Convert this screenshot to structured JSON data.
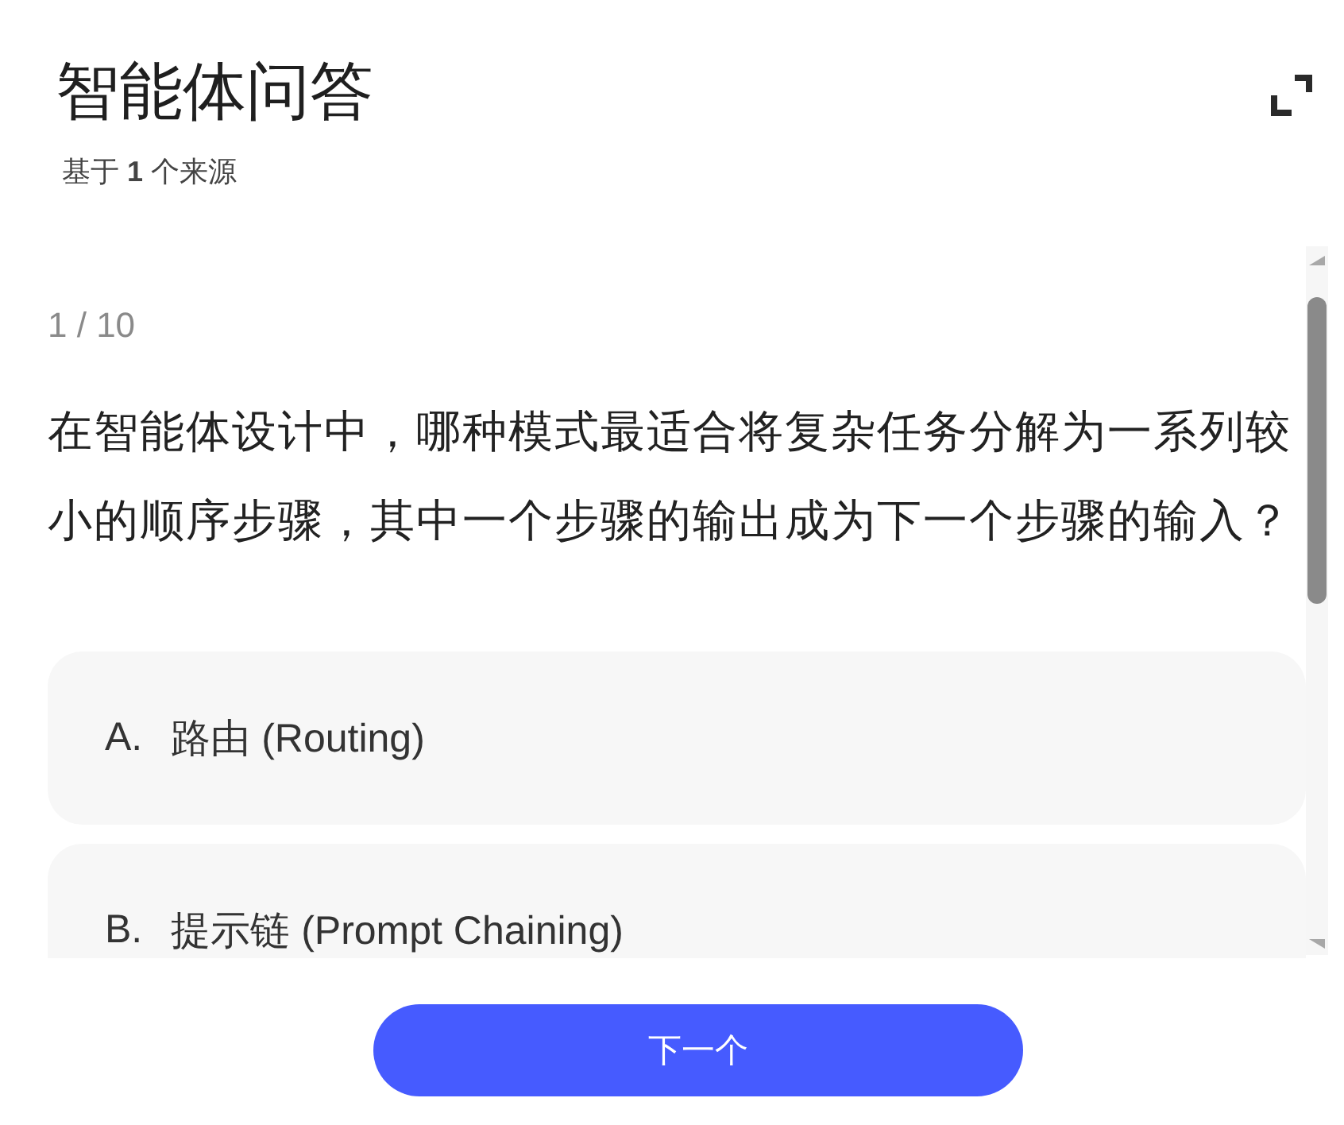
{
  "header": {
    "title": "智能体问答",
    "subtitle": "基于 **1** 个来源"
  },
  "quiz": {
    "counter": "1 / 10",
    "question": "在智能体设计中，哪种模式最适合将复杂任务分解为一系列较小的顺序步骤，其中一个步骤的输出成为下一个步骤的输入？",
    "options": [
      {
        "letter": "A.",
        "text": "路由 (Routing)"
      },
      {
        "letter": "B.",
        "text": "提示链 (Prompt Chaining)"
      }
    ]
  },
  "next_button": {
    "label": "下一个"
  }
}
